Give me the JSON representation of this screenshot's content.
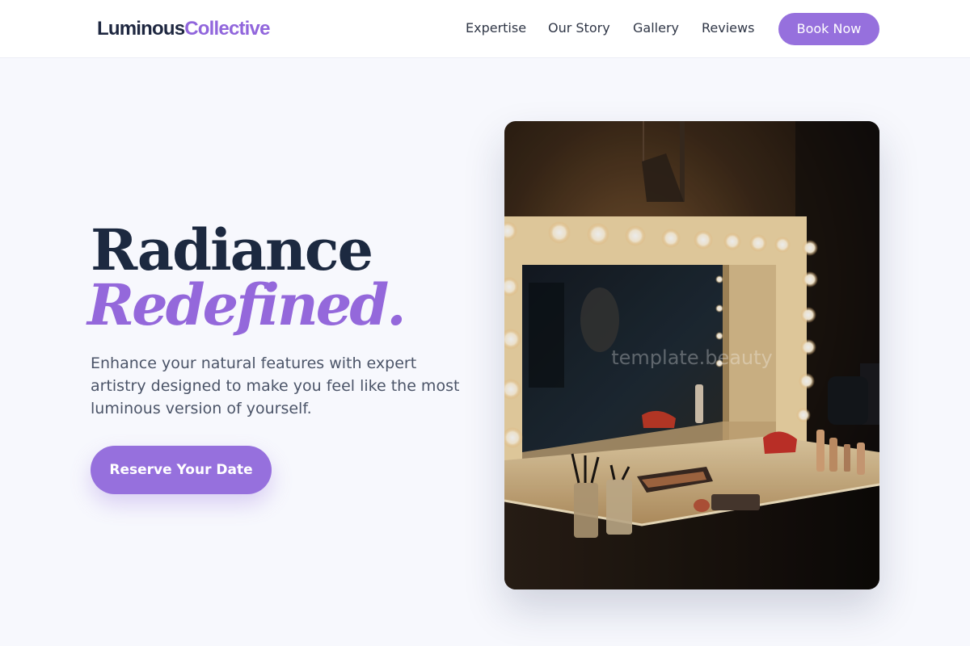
{
  "brand": {
    "name_part_1": "Luminous",
    "name_part_2": "Collective",
    "accent_color": "#9670dd"
  },
  "nav": {
    "items": [
      {
        "label": "Expertise"
      },
      {
        "label": "Our Story"
      },
      {
        "label": "Gallery"
      },
      {
        "label": "Reviews"
      }
    ],
    "cta_label": "Book Now"
  },
  "hero": {
    "title_line_1": "Radiance",
    "title_line_2": "Redefined.",
    "subtitle": "Enhance your natural features with expert artistry designed to make you feel like the most luminous version of yourself.",
    "cta_label": "Reserve Your Date",
    "image": {
      "subject": "vanity-mirror-with-lights",
      "watermark": "template.beauty"
    }
  }
}
